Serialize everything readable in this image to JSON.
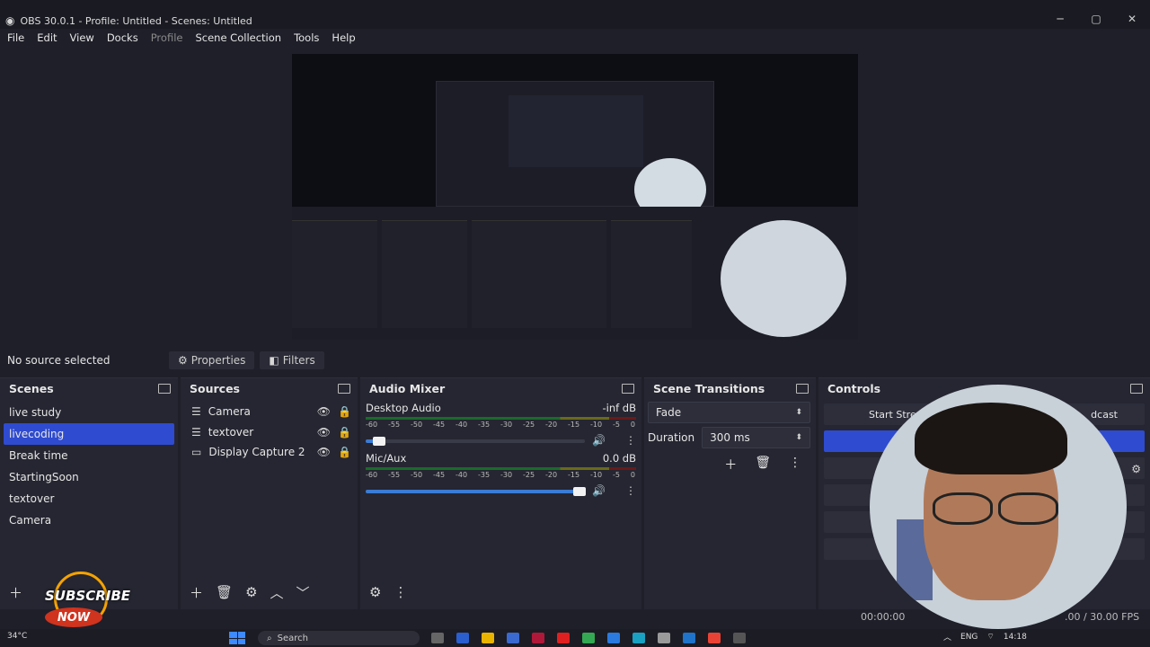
{
  "window": {
    "title": "OBS 30.0.1 - Profile: Untitled - Scenes: Untitled",
    "minimize": "─",
    "maximize": "▢",
    "close": "✕"
  },
  "menu": [
    "File",
    "Edit",
    "View",
    "Docks",
    "Profile",
    "Scene Collection",
    "Tools",
    "Help"
  ],
  "source_bar": {
    "no_source": "No source selected",
    "properties": "Properties",
    "filters": "Filters"
  },
  "scenes": {
    "title": "Scenes",
    "items": [
      "live study",
      "livecoding",
      "Break time",
      "StartingSoon",
      "textover",
      "Camera"
    ],
    "selected_index": 1
  },
  "sources": {
    "title": "Sources",
    "items": [
      {
        "name": "Camera",
        "icon": "list-icon"
      },
      {
        "name": "textover",
        "icon": "list-icon"
      },
      {
        "name": "Display Capture 2",
        "icon": "monitor-icon"
      }
    ]
  },
  "mixer": {
    "title": "Audio Mixer",
    "ticks": [
      "-60",
      "-55",
      "-50",
      "-45",
      "-40",
      "-35",
      "-30",
      "-25",
      "-20",
      "-15",
      "-10",
      "-5",
      "0"
    ],
    "channels": [
      {
        "name": "Desktop Audio",
        "db": "-inf dB",
        "volume": 0.06
      },
      {
        "name": "Mic/Aux",
        "db": "0.0 dB",
        "volume": 0.95
      }
    ]
  },
  "transitions": {
    "title": "Scene Transitions",
    "type": "Fade",
    "duration_label": "Duration",
    "duration_value": "300 ms"
  },
  "controls": {
    "title": "Controls",
    "start_streaming": "Start Stre",
    "broadcast": "dcast"
  },
  "status": {
    "time": "00:00:00",
    "fps": ".00 / 30.00 FPS"
  },
  "overlay": {
    "subscribe": "SUBSCRIBE",
    "now": "NOW"
  },
  "taskbar": {
    "temp": "34°C",
    "search": "Search",
    "lang": "ENG",
    "clock": "14:18"
  },
  "colors": {
    "accent": "#2f4bd0",
    "bg": "#1e1f29",
    "dock": "#252631"
  }
}
